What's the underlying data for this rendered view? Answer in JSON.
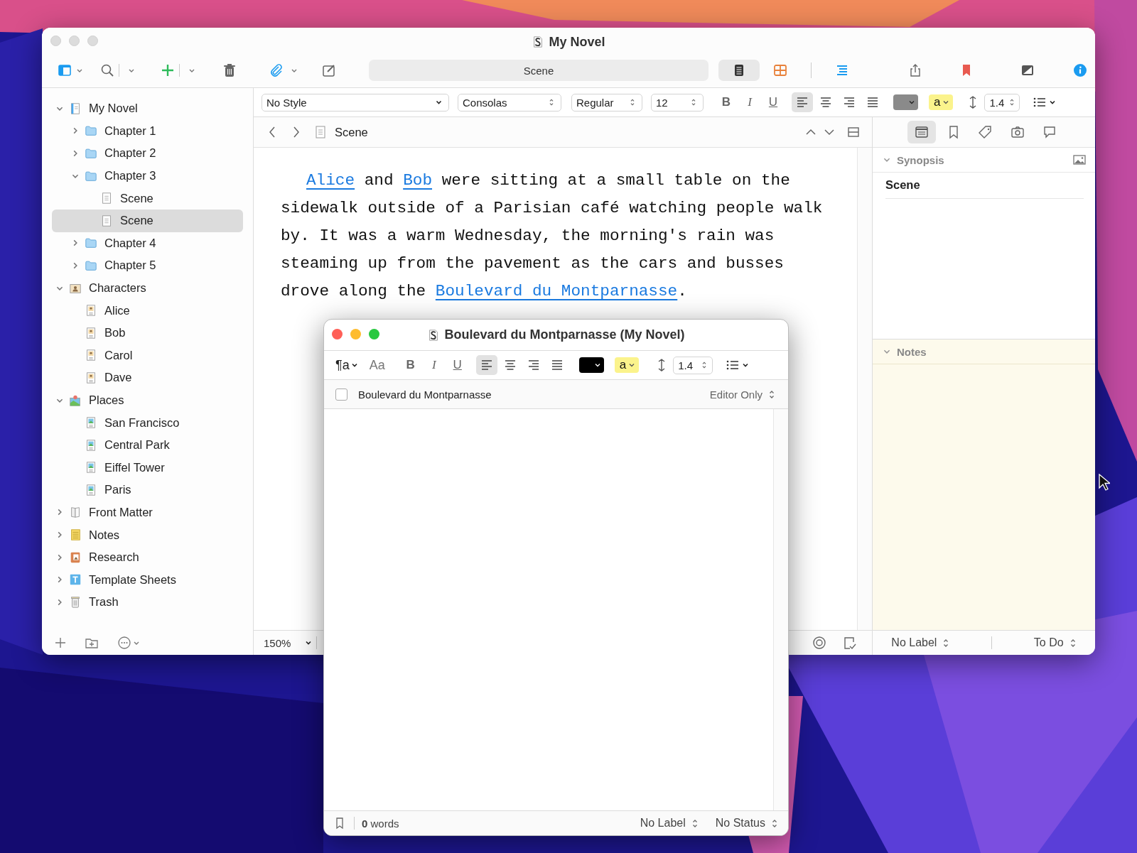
{
  "window": {
    "title": "My Novel"
  },
  "toolbar": {
    "scene_field": "Scene",
    "view_modes": [
      {
        "kind": "document",
        "selected": true
      },
      {
        "kind": "corkboard",
        "selected": false
      },
      {
        "kind": "outline",
        "selected": false
      }
    ]
  },
  "binder": [
    {
      "label": "My Novel",
      "kind": "draft",
      "expanded": true,
      "selected": false,
      "children": [
        {
          "label": "Chapter 1",
          "kind": "folder",
          "expanded": false,
          "selected": false
        },
        {
          "label": "Chapter 2",
          "kind": "folder",
          "expanded": false,
          "selected": false
        },
        {
          "label": "Chapter 3",
          "kind": "folder",
          "expanded": true,
          "selected": false,
          "children": [
            {
              "label": "Scene",
              "kind": "document",
              "selected": false
            },
            {
              "label": "Scene",
              "kind": "document",
              "selected": true
            }
          ]
        },
        {
          "label": "Chapter 4",
          "kind": "folder",
          "expanded": false,
          "selected": false
        },
        {
          "label": "Chapter 5",
          "kind": "folder",
          "expanded": false,
          "selected": false
        }
      ]
    },
    {
      "label": "Characters",
      "kind": "characters",
      "expanded": true,
      "selected": false,
      "children": [
        {
          "label": "Alice",
          "kind": "character",
          "selected": false
        },
        {
          "label": "Bob",
          "kind": "character",
          "selected": false
        },
        {
          "label": "Carol",
          "kind": "character",
          "selected": false
        },
        {
          "label": "Dave",
          "kind": "character",
          "selected": false
        }
      ]
    },
    {
      "label": "Places",
      "kind": "places",
      "expanded": true,
      "selected": false,
      "children": [
        {
          "label": "San Francisco",
          "kind": "place",
          "selected": false
        },
        {
          "label": "Central Park",
          "kind": "place",
          "selected": false
        },
        {
          "label": "Eiffel Tower",
          "kind": "place",
          "selected": false
        },
        {
          "label": "Paris",
          "kind": "place",
          "selected": false
        }
      ]
    },
    {
      "label": "Front Matter",
      "kind": "frontmatter",
      "expanded": false,
      "selected": false
    },
    {
      "label": "Notes",
      "kind": "notes",
      "expanded": false,
      "selected": false
    },
    {
      "label": "Research",
      "kind": "research",
      "expanded": false,
      "selected": false
    },
    {
      "label": "Template Sheets",
      "kind": "template",
      "expanded": false,
      "selected": false
    },
    {
      "label": "Trash",
      "kind": "trash",
      "expanded": false,
      "selected": false
    }
  ],
  "format_bar": {
    "style": "No Style",
    "font": "Consolas",
    "weight": "Regular",
    "size": "12",
    "bold": "B",
    "italic": "I",
    "underline": "U",
    "alignments": [
      {
        "kind": "left",
        "selected": true
      },
      {
        "kind": "center",
        "selected": false
      },
      {
        "kind": "right",
        "selected": false
      },
      {
        "kind": "justify",
        "selected": false
      }
    ],
    "highlight": "a",
    "line_spacing": "1.4"
  },
  "editor": {
    "title": "Scene",
    "paragraph": [
      {
        "kind": "link",
        "text": "Alice"
      },
      {
        "kind": "text",
        "text": " and "
      },
      {
        "kind": "link",
        "text": "Bob"
      },
      {
        "kind": "text",
        "text": " were sitting at a small table on the sidewalk outside of a Parisian café watching people walk by. It was a warm Wednesday, the morning's rain was steaming up from the pavement as the cars and busses drove along the "
      },
      {
        "kind": "link",
        "text": "Boulevard du Montparnasse"
      },
      {
        "kind": "text",
        "text": "."
      }
    ],
    "zoom": "150%"
  },
  "inspector": {
    "tabs": [
      {
        "kind": "notes",
        "selected": true
      },
      {
        "kind": "bookmarks",
        "selected": false
      },
      {
        "kind": "metadata",
        "selected": false
      },
      {
        "kind": "snapshots",
        "selected": false
      },
      {
        "kind": "comments",
        "selected": false
      }
    ],
    "synopsis": {
      "heading": "Synopsis",
      "expanded": true,
      "title": "Scene"
    },
    "notes": {
      "heading": "Notes",
      "expanded": true
    },
    "label": "No Label",
    "status": "To Do"
  },
  "quick_reference": {
    "title": "Boulevard du Montparnasse (My Novel)",
    "paragraph_style": "¶a",
    "fonts": "Aa",
    "bold": "B",
    "italic": "I",
    "underline": "U",
    "alignments": [
      {
        "kind": "left",
        "selected": true
      },
      {
        "kind": "center",
        "selected": false
      },
      {
        "kind": "right",
        "selected": false
      },
      {
        "kind": "justify",
        "selected": false
      }
    ],
    "highlight": "a",
    "line_spacing": "1.4",
    "document_title": "Boulevard du Montparnasse",
    "checked": false,
    "view": "Editor Only",
    "word_count": "**0** words",
    "label": "No Label",
    "status": "No Status"
  }
}
